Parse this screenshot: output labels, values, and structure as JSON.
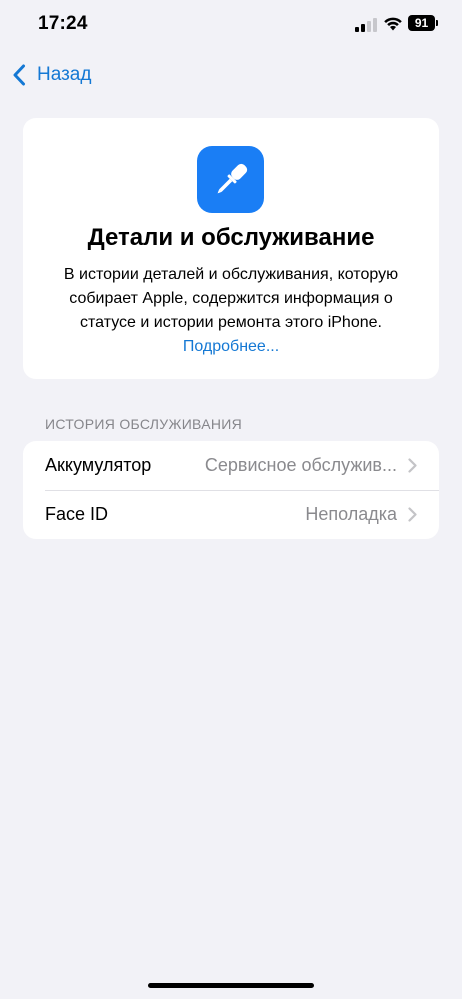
{
  "status_bar": {
    "time": "17:24",
    "battery": "91",
    "icons": [
      "cellular-signal-icon",
      "wifi-icon",
      "battery-icon"
    ]
  },
  "nav": {
    "back_label": "Назад",
    "back_icon": "chevron-left-icon"
  },
  "info_card": {
    "icon": "screwdriver-icon",
    "title": "Детали и обслуживание",
    "body": "В истории деталей и обслуживания, которую собирает Apple, содержится информация о статусе и истории ремонта этого iPhone. ",
    "link": "Подробнее..."
  },
  "service_history": {
    "header": "ИСТОРИЯ ОБСЛУЖИВАНИЯ",
    "rows": [
      {
        "label": "Аккумулятор",
        "value": "Сервисное обслужив..."
      },
      {
        "label": "Face ID",
        "value": "Неполадка"
      }
    ]
  },
  "colors": {
    "accent": "#1478d4",
    "background": "#f2f2f7",
    "icon_bg": "#1a7ef5",
    "secondary_text": "#8a8a8e"
  }
}
